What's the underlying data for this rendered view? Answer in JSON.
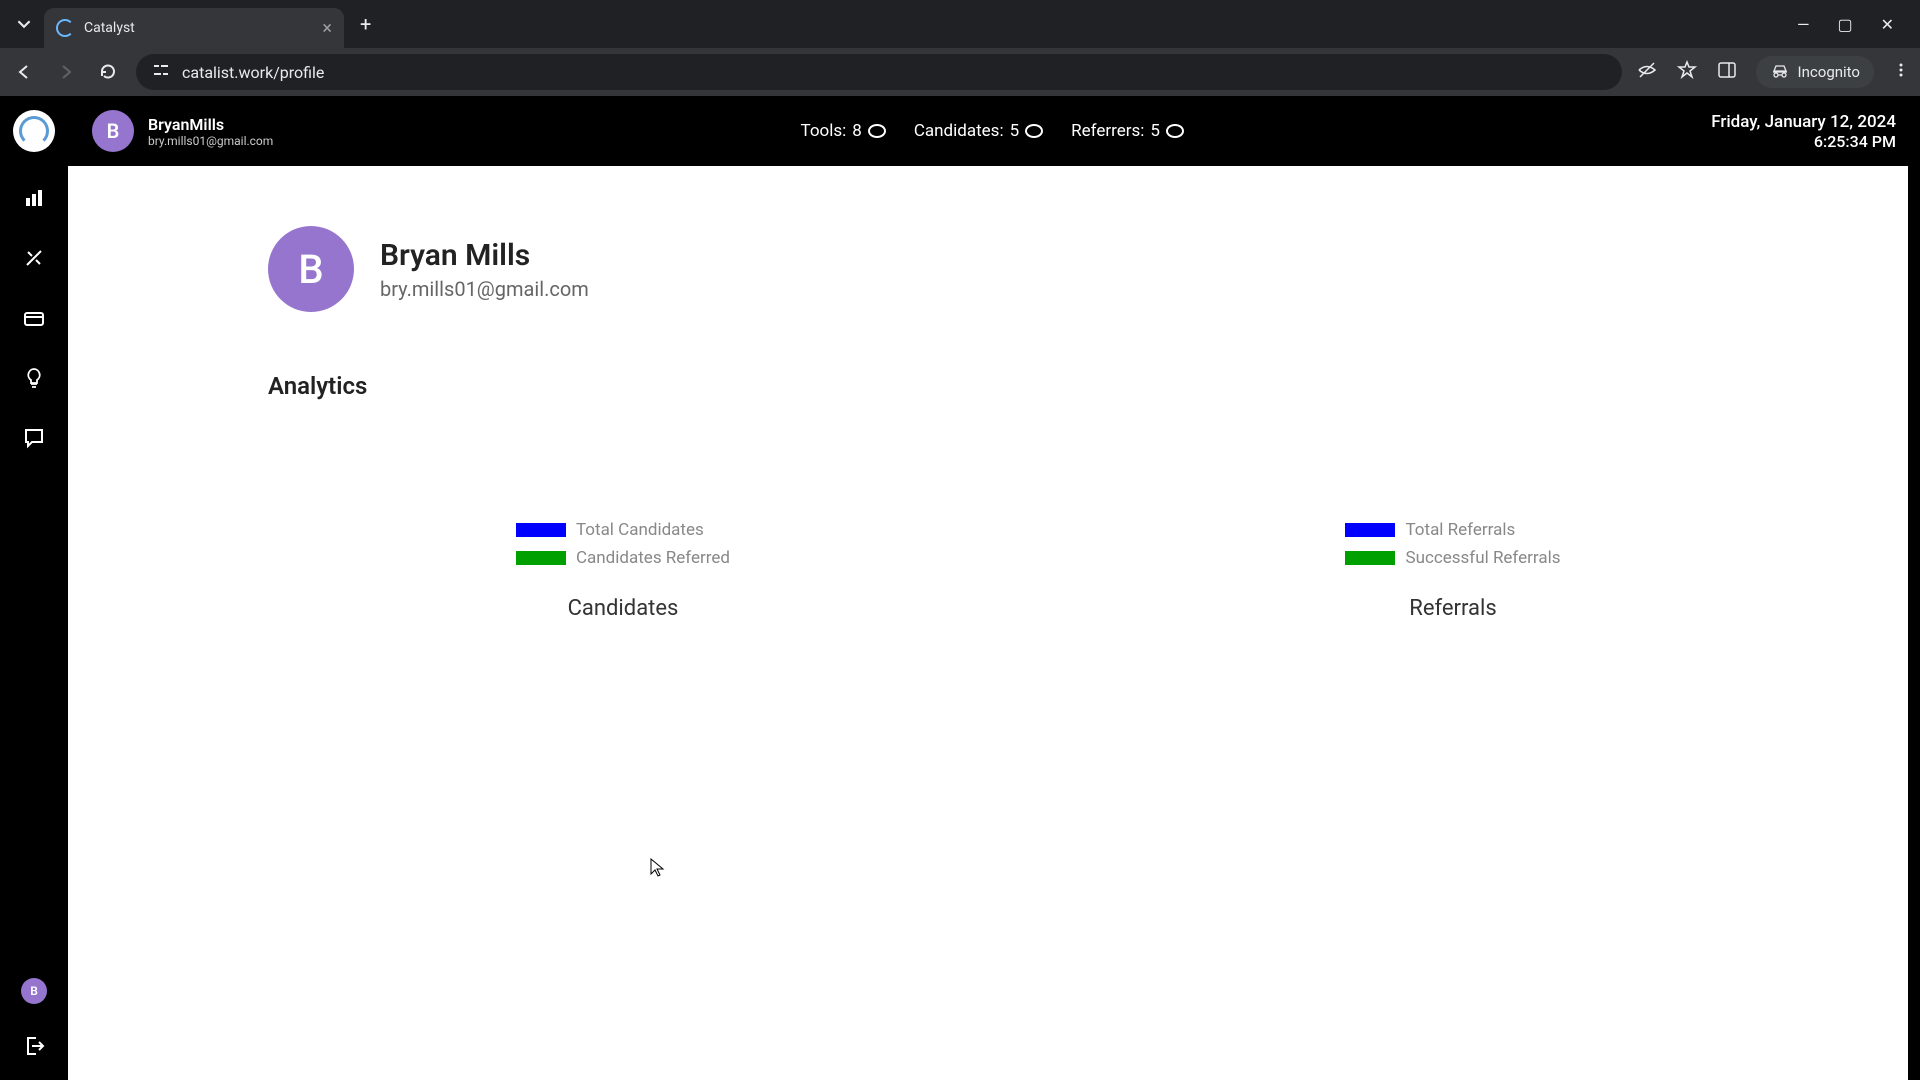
{
  "browser": {
    "tab_title": "Catalyst",
    "url": "catalist.work/profile",
    "incognito_label": "Incognito"
  },
  "topbar": {
    "username": "BryanMills",
    "email": "bry.mills01@gmail.com",
    "avatar_initial": "B",
    "stats": {
      "tools_label": "Tools:",
      "tools_count": "8",
      "candidates_label": "Candidates:",
      "candidates_count": "5",
      "referrers_label": "Referrers:",
      "referrers_count": "5"
    },
    "date": "Friday, January 12, 2024",
    "time": "6:25:34 PM"
  },
  "profile": {
    "avatar_initial": "B",
    "name": "Bryan Mills",
    "email": "bry.mills01@gmail.com"
  },
  "analytics": {
    "title": "Analytics",
    "chart1": {
      "legend1": "Total Candidates",
      "legend2": "Candidates Referred",
      "title": "Candidates"
    },
    "chart2": {
      "legend1": "Total Referrals",
      "legend2": "Successful Referrals",
      "title": "Referrals"
    }
  },
  "sidebar": {
    "mini_avatar_initial": "B"
  },
  "chart_data": [
    {
      "type": "bar",
      "title": "Candidates",
      "series": [
        {
          "name": "Total Candidates",
          "color": "#0000ff",
          "values": []
        },
        {
          "name": "Candidates Referred",
          "color": "#00a000",
          "values": []
        }
      ],
      "note": "chart area blank in screenshot; only legend visible"
    },
    {
      "type": "bar",
      "title": "Referrals",
      "series": [
        {
          "name": "Total Referrals",
          "color": "#0000ff",
          "values": []
        },
        {
          "name": "Successful Referrals",
          "color": "#00a000",
          "values": []
        }
      ],
      "note": "chart area blank in screenshot; only legend visible"
    }
  ]
}
